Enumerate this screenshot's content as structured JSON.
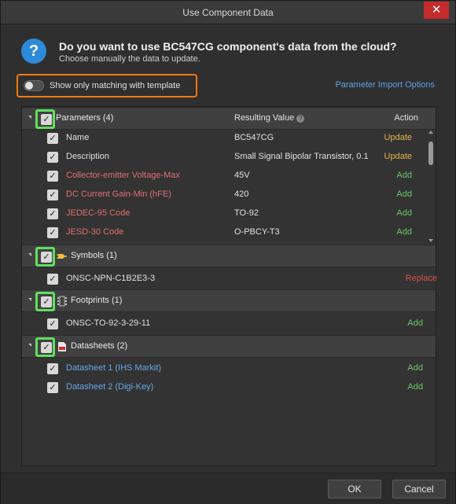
{
  "window": {
    "title": "Use Component Data",
    "close_label": "✕"
  },
  "prompt": {
    "icon": "question-icon",
    "question": "Do you want to use BC547CG component's data from the cloud?",
    "subtext": "Choose manually the data to update."
  },
  "toggle": {
    "label": "Show only matching with template",
    "on": false
  },
  "link": {
    "label": "Parameter Import Options"
  },
  "columns": {
    "value": "Resulting Value",
    "action": "Action"
  },
  "groups": {
    "parameters": {
      "title": "Parameters (4)",
      "rows": [
        {
          "name": "Name",
          "value": "BC547CG",
          "action": "Update"
        },
        {
          "name": "Description",
          "value": "Small Signal Bipolar Transistor, 0.1",
          "action": "Update"
        },
        {
          "name": "Collector-emitter Voltage-Max",
          "value": "45V",
          "action": "Add"
        },
        {
          "name": "DC Current Gain-Min (hFE)",
          "value": "420",
          "action": "Add"
        },
        {
          "name": "JEDEC-95 Code",
          "value": "TO-92",
          "action": "Add"
        },
        {
          "name": "JESD-30 Code",
          "value": "O-PBCY-T3",
          "action": "Add"
        }
      ]
    },
    "symbols": {
      "title": "Symbols (1)",
      "rows": [
        {
          "name": "ONSC-NPN-C1B2E3-3",
          "action": "Replace"
        }
      ]
    },
    "footprints": {
      "title": "Footprints (1)",
      "rows": [
        {
          "name": "ONSC-TO-92-3-29-11",
          "action": "Add"
        }
      ]
    },
    "datasheets": {
      "title": "Datasheets (2)",
      "rows": [
        {
          "name": "Datasheet 1 (IHS Markit)",
          "action": "Add"
        },
        {
          "name": "Datasheet 2 (Digi-Key)",
          "action": "Add"
        }
      ]
    }
  },
  "buttons": {
    "ok": "OK",
    "cancel": "Cancel"
  },
  "colors": {
    "highlight_green": "#5fe05f",
    "highlight_orange": "#f07a10",
    "update": "#e6b34a",
    "add": "#6cc46c",
    "replace": "#d85050",
    "link": "#5ea2e6"
  }
}
